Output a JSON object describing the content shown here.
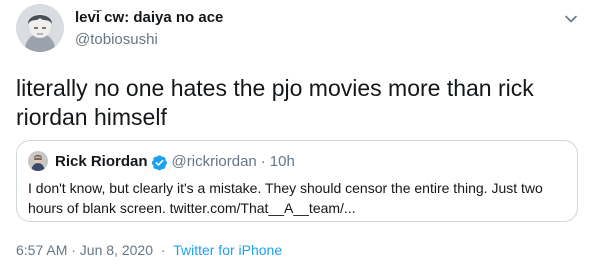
{
  "author": {
    "display_name": "levi̅ cw: daiya no ace",
    "handle": "@tobiosushi"
  },
  "tweet": {
    "text": "literally no one hates the pjo movies more than rick riordan himself"
  },
  "quoted_tweet": {
    "display_name": "Rick Riordan",
    "handle": "@rickriordan",
    "separator": "·",
    "time": "10h",
    "text": "I don't know, but clearly it's a mistake. They should censor the entire thing. Just two hours of blank screen. twitter.com/That__A__team/..."
  },
  "meta": {
    "timestamp": "6:57 AM · Jun 8, 2020",
    "separator": "·",
    "source": "Twitter for iPhone"
  },
  "icons": {
    "verified": "verified-badge-icon",
    "caret": "chevron-down-icon"
  },
  "colors": {
    "accent": "#1da1f2",
    "secondary_text": "#657786",
    "border": "#ccd6dd"
  }
}
